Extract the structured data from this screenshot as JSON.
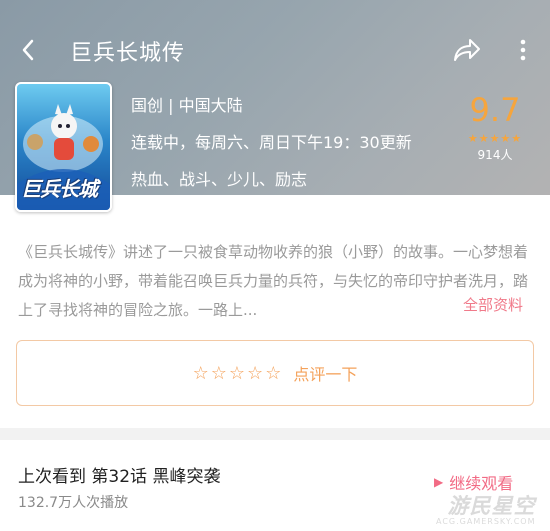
{
  "header": {
    "title": "巨兵长城传",
    "back_icon": "back-arrow-icon",
    "share_icon": "share-arrow-icon",
    "more_icon": "more-vertical-icon"
  },
  "info": {
    "origin": "国创 | 中国大陆",
    "schedule": "连载中，每周六、周日下午19：30更新",
    "tags": "热血、战斗、少儿、励志",
    "score": "9.7",
    "rating_count": "914人",
    "stars": "★★★★★",
    "cover_title": "巨兵长城"
  },
  "synopsis": {
    "text": "《巨兵长城传》讲述了一只被食草动物收养的狼（小野）的故事。一心梦想着成为将神的小野，带着能召唤巨兵力量的兵符，与失忆的帝印守护者洗月，踏上了寻找将神的冒险之旅。一路上...",
    "more_label": "全部资料"
  },
  "review": {
    "stars": "☆☆☆☆☆",
    "label": "点评一下"
  },
  "history": {
    "last_watched": "上次看到  第32话  黑峰突袭",
    "play_count": "132.7万人次播放",
    "continue_label": "继续观看"
  },
  "watermark": {
    "cn": "游民星空",
    "en": "ACG.GAMERSKY.COM"
  },
  "colors": {
    "accent_orange": "#f6a53d",
    "accent_pink": "#f26b85",
    "header_bg": "#97a5ae"
  }
}
